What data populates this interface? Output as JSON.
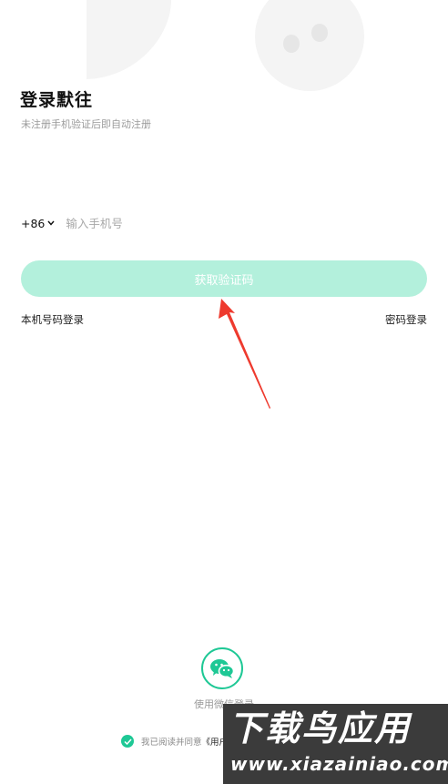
{
  "header": {
    "title": "登录默往",
    "subtitle": "未注册手机验证后即自动注册"
  },
  "phone": {
    "country_code": "+86",
    "placeholder": "输入手机号",
    "value": ""
  },
  "get_code_button": {
    "label": "获取验证码"
  },
  "links": {
    "local_login": "本机号码登录",
    "password_login": "密码登录"
  },
  "wechat": {
    "label": "使用微信登录"
  },
  "agreement": {
    "text": "我已阅读并同意",
    "link_text": "《用户",
    "checked": true
  },
  "watermark": {
    "top": "下载鸟应用",
    "bottom": "www.xiazainiao.com"
  },
  "colors": {
    "accent": "#1ec895",
    "button_bg": "#b3f0dc",
    "annotation_arrow": "#ee3a2e"
  }
}
